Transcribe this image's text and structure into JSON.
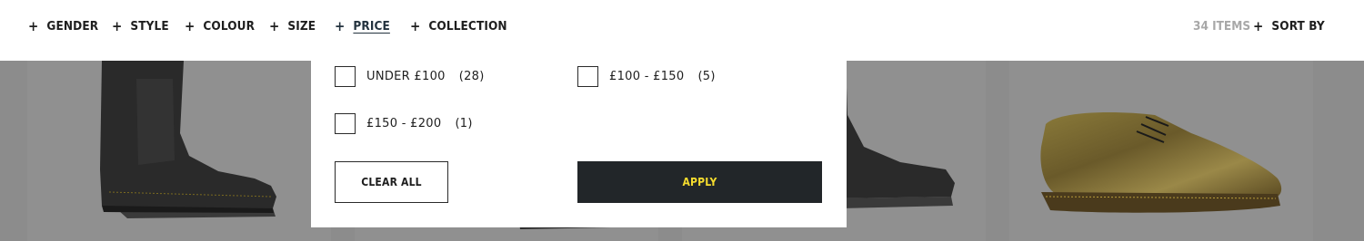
{
  "filters": [
    {
      "plus": "+",
      "label": "GENDER"
    },
    {
      "plus": "+",
      "label": "STYLE"
    },
    {
      "plus": "+",
      "label": "COLOUR"
    },
    {
      "plus": "+",
      "label": "SIZE"
    },
    {
      "plus": "+",
      "label": "PRICE"
    },
    {
      "plus": "+",
      "label": "COLLECTION"
    }
  ],
  "results": {
    "count_text": "34 ITEMS"
  },
  "sort": {
    "plus": "+",
    "label": "SORT BY"
  },
  "price_panel": {
    "options": [
      {
        "label": "UNDER £100",
        "count": "(28)",
        "checked": false
      },
      {
        "label": "£100 - £150",
        "count": "(5)",
        "checked": false
      },
      {
        "label": "£150 - £200",
        "count": "(1)",
        "checked": false
      }
    ],
    "clear_label": "CLEAR ALL",
    "apply_label": "APPLY"
  },
  "products": [
    {
      "icon": "black-chelsea-boot-image"
    },
    {
      "icon": "black-boot-image"
    },
    {
      "icon": "black-chelsea-boot-image"
    },
    {
      "icon": "metallic-lace-up-shoe-image"
    }
  ],
  "colors": {
    "accent_text": "#f5dc2e",
    "apply_bg": "#222629",
    "overlay": "#8c8c8c"
  }
}
